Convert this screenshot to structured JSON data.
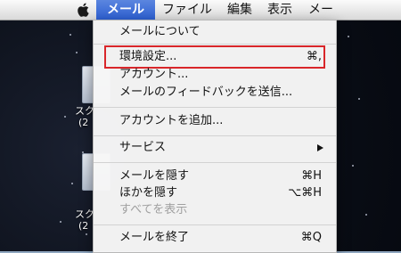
{
  "menubar": {
    "items": [
      "メール",
      "ファイル",
      "編集",
      "表示",
      "メー"
    ]
  },
  "desktop": {
    "labels": [
      "スク",
      "(2",
      "スク",
      "(2"
    ]
  },
  "menu": {
    "about": "メールについて",
    "preferences": {
      "label": "環境設定...",
      "shortcut": "⌘,"
    },
    "accounts": "アカウント...",
    "feedback": "メールのフィードバックを送信...",
    "add_account": "アカウントを追加...",
    "services": "サービス",
    "hide_mail": {
      "label": "メールを隠す",
      "shortcut": "⌘H"
    },
    "hide_others": {
      "label": "ほかを隠す",
      "shortcut": "⌥⌘H"
    },
    "show_all": "すべてを表示",
    "quit": {
      "label": "メールを終了",
      "shortcut": "⌘Q"
    }
  },
  "colors": {
    "highlight": "#d9262a",
    "menu_active": "#2d5fd1"
  }
}
